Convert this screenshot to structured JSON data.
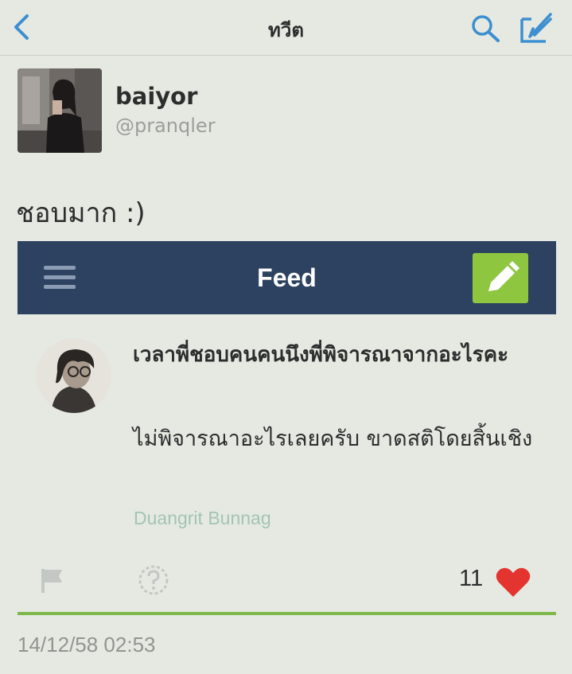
{
  "nav": {
    "title": "ทวีต",
    "back_icon": "chevron-left-icon",
    "search_icon": "search-icon",
    "compose_icon": "compose-icon",
    "accent_color": "#3d8fd1"
  },
  "tweet": {
    "display_name": "baiyor",
    "handle": "@pranqler",
    "text": "ชอบมาก :)",
    "timestamp": "14/12/58 02:53"
  },
  "embed": {
    "header_title": "Feed",
    "header_color": "#2c4260",
    "edit_button_color": "#8ec63f",
    "question": "เวลาพี่ชอบคนคนนึงพี่พิจารณาจากอะไรคะ",
    "answer": "ไม่พิจารณาอะไรเลยครับ ขาดสติโดยสิ้นเชิง",
    "author": "Duangrit Bunnag",
    "like_count": "11",
    "heart_color": "#e3342f"
  }
}
